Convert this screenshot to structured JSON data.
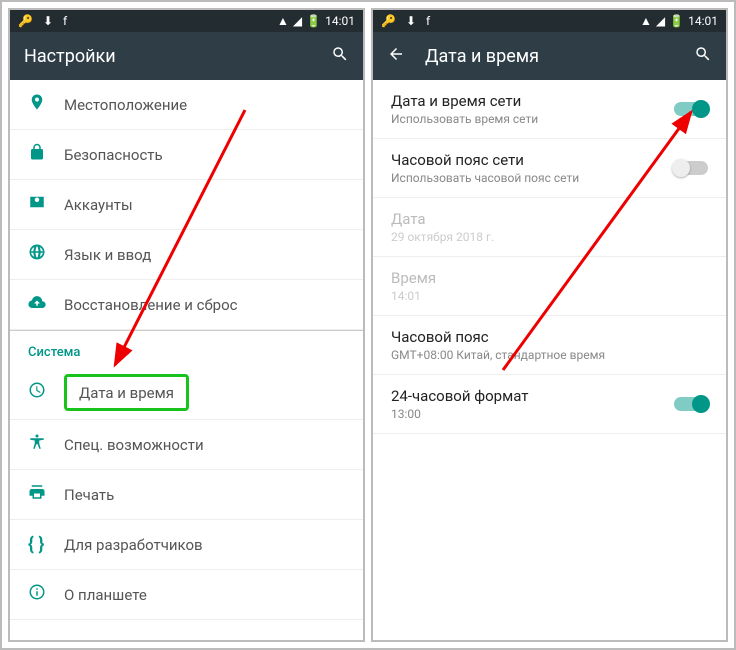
{
  "status": {
    "time": "14:01",
    "icons_left": [
      "key-icon",
      "download-icon",
      "facebook-icon"
    ],
    "icons_right": [
      "wifi-icon",
      "signal-icon",
      "battery-icon"
    ]
  },
  "left": {
    "title": "Настройки",
    "items": [
      {
        "icon": "location-icon",
        "label": "Местоположение"
      },
      {
        "icon": "lock-icon",
        "label": "Безопасность"
      },
      {
        "icon": "account-icon",
        "label": "Аккаунты"
      },
      {
        "icon": "globe-icon",
        "label": "Язык и ввод"
      },
      {
        "icon": "backup-icon",
        "label": "Восстановление и сброс"
      }
    ],
    "section": "Система",
    "system_items": [
      {
        "icon": "clock-icon",
        "label": "Дата и время",
        "highlight": true
      },
      {
        "icon": "accessibility-icon",
        "label": "Спец. возможности"
      },
      {
        "icon": "print-icon",
        "label": "Печать"
      },
      {
        "icon": "braces-icon",
        "label": "Для разработчиков"
      },
      {
        "icon": "info-icon",
        "label": "О планшете"
      }
    ]
  },
  "right": {
    "title": "Дата и время",
    "rows": [
      {
        "title": "Дата и время сети",
        "sub": "Использовать время сети",
        "toggle": "on"
      },
      {
        "title": "Часовой пояс сети",
        "sub": "Использовать часовой пояс сети",
        "toggle": "off"
      },
      {
        "title": "Дата",
        "sub": "29 октября 2018 г.",
        "disabled": true
      },
      {
        "title": "Время",
        "sub": "14:01",
        "disabled": true
      },
      {
        "title": "Часовой пояс",
        "sub": "GMT+08:00 Китай, стандартное время"
      },
      {
        "title": "24-часовой формат",
        "sub": "13:00",
        "toggle": "on"
      }
    ]
  }
}
